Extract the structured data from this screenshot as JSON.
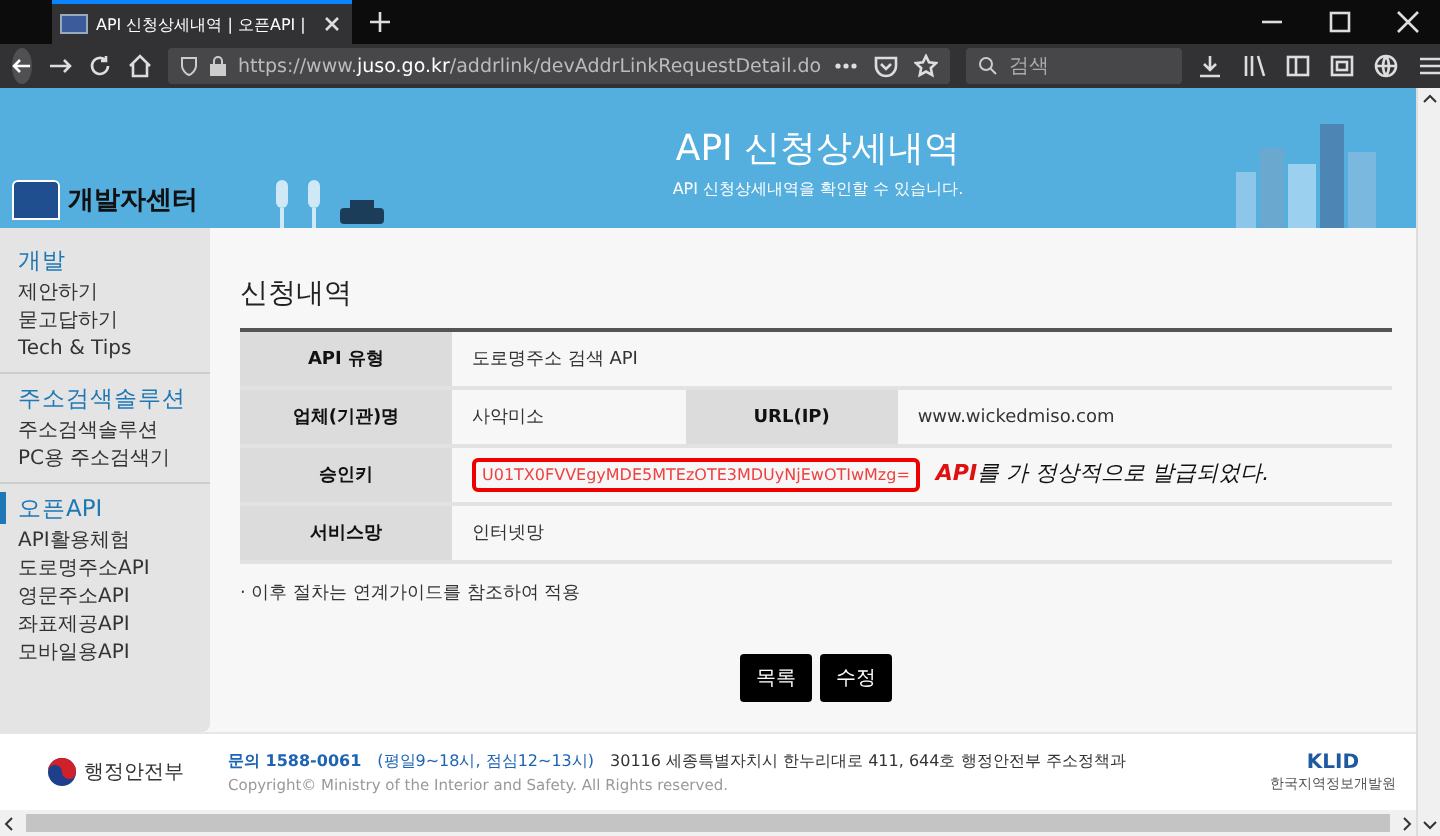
{
  "browser": {
    "tab_title": "API 신청상세내역 | 오픈API |",
    "url_prefix": "https://www.",
    "url_domain": "juso.go.kr",
    "url_path": "/addrlink/devAddrLinkRequestDetail.do",
    "search_placeholder": "검색"
  },
  "banner": {
    "logo_text": "개발자센터",
    "title": "API 신청상세내역",
    "subtitle": "API 신청상세내역을 확인할 수 있습니다."
  },
  "sidebar": {
    "sections": [
      {
        "title": "개발",
        "selected": false,
        "items": [
          "제안하기",
          "묻고답하기",
          "Tech & Tips"
        ]
      },
      {
        "title": "주소검색솔루션",
        "selected": false,
        "items": [
          "주소검색솔루션",
          "PC용 주소검색기"
        ]
      },
      {
        "title": "오픈API",
        "selected": true,
        "items": [
          "API활용체험",
          "도로명주소API",
          "영문주소API",
          "좌표제공API",
          "모바일용API"
        ]
      }
    ]
  },
  "content": {
    "title": "신청내역",
    "rows": [
      {
        "kind": "single",
        "label": "API 유형",
        "value": "도로명주소 검색 API"
      },
      {
        "kind": "pair",
        "label": "업체(기관)명",
        "value": "사악미소",
        "label_2": "URL(IP)",
        "value_2": "www.wickedmiso.com"
      },
      {
        "kind": "key",
        "label": "승인키",
        "value": "U01TX0FVVEgyMDE5MTEzOTE3MDUyNjEwOTIwMzg=",
        "annotation_highlight": "API",
        "annotation_rest": "를 가 정상적으로 발급되었다."
      },
      {
        "kind": "single",
        "label": "서비스망",
        "value": "인터넷망"
      }
    ],
    "note": "· 이후 절차는 연계가이드를 참조하여 적용",
    "buttons": [
      "목록",
      "수정"
    ]
  },
  "footer": {
    "ministry": "행정안전부",
    "phone": "문의 1588-0061",
    "hours": "(평일9~18시, 점심12~13시)",
    "address": "30116 세종특별자치시 한누리대로 411, 644호 행정안전부 주소정책과",
    "copyright": "Copyright© Ministry of the Interior and Safety. All Rights reserved.",
    "partner_logo": "KLID",
    "partner_name": "한국지역정보개발원"
  }
}
